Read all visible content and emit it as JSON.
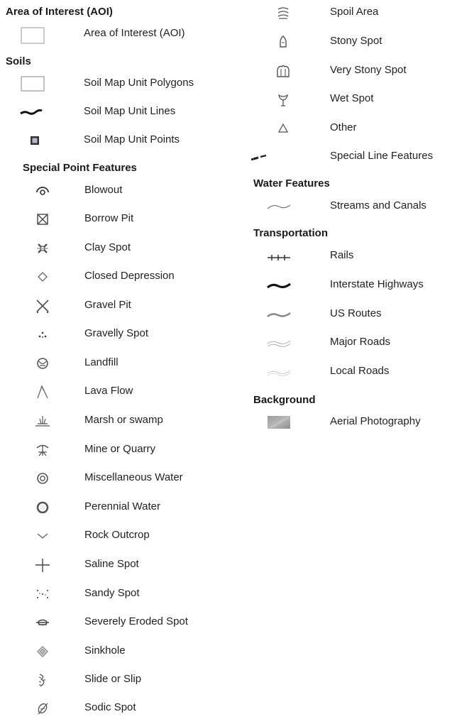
{
  "left_column": {
    "sections": [
      {
        "heading": "Area of Interest (AOI)",
        "items": [
          {
            "icon": "aoi-box-icon",
            "label": "Area of Interest (AOI)"
          }
        ]
      },
      {
        "heading": "Soils",
        "items": [
          {
            "icon": "soil-polygon-box-icon",
            "label": "Soil Map Unit Polygons"
          },
          {
            "icon": "soil-line-icon",
            "label": "Soil Map Unit Lines"
          },
          {
            "icon": "soil-point-square-icon",
            "label": "Soil Map Unit Points"
          }
        ]
      },
      {
        "heading": "Special Point Features",
        "items": [
          {
            "icon": "blowout-icon",
            "label": "Blowout"
          },
          {
            "icon": "borrow-pit-icon",
            "label": "Borrow Pit"
          },
          {
            "icon": "clay-spot-icon",
            "label": "Clay Spot"
          },
          {
            "icon": "closed-depression-icon",
            "label": "Closed Depression"
          },
          {
            "icon": "gravel-pit-icon",
            "label": "Gravel Pit"
          },
          {
            "icon": "gravelly-spot-icon",
            "label": "Gravelly Spot"
          },
          {
            "icon": "landfill-icon",
            "label": "Landfill"
          },
          {
            "icon": "lava-flow-icon",
            "label": "Lava Flow"
          },
          {
            "icon": "marsh-icon",
            "label": "Marsh or swamp"
          },
          {
            "icon": "mine-quarry-icon",
            "label": "Mine or Quarry"
          },
          {
            "icon": "misc-water-icon",
            "label": "Miscellaneous Water"
          },
          {
            "icon": "perennial-water-icon",
            "label": "Perennial Water"
          },
          {
            "icon": "rock-outcrop-icon",
            "label": "Rock Outcrop"
          },
          {
            "icon": "saline-spot-icon",
            "label": "Saline Spot"
          },
          {
            "icon": "sandy-spot-icon",
            "label": "Sandy Spot"
          },
          {
            "icon": "eroded-spot-icon",
            "label": "Severely Eroded Spot"
          },
          {
            "icon": "sinkhole-icon",
            "label": "Sinkhole"
          },
          {
            "icon": "slide-slip-icon",
            "label": "Slide or Slip"
          },
          {
            "icon": "sodic-spot-icon",
            "label": "Sodic Spot"
          }
        ]
      }
    ]
  },
  "right_column": {
    "sections": [
      {
        "heading": "",
        "items": [
          {
            "icon": "spoil-area-icon",
            "label": "Spoil Area"
          },
          {
            "icon": "stony-spot-icon",
            "label": "Stony Spot"
          },
          {
            "icon": "very-stony-spot-icon",
            "label": "Very Stony Spot"
          },
          {
            "icon": "wet-spot-icon",
            "label": "Wet Spot"
          },
          {
            "icon": "other-triangle-icon",
            "label": "Other"
          },
          {
            "icon": "special-line-icon",
            "label": "Special Line Features"
          }
        ]
      },
      {
        "heading": "Water Features",
        "items": [
          {
            "icon": "stream-line-icon",
            "label": "Streams and Canals"
          }
        ]
      },
      {
        "heading": "Transportation",
        "items": [
          {
            "icon": "rails-icon",
            "label": "Rails"
          },
          {
            "icon": "interstate-line-icon",
            "label": "Interstate Highways"
          },
          {
            "icon": "us-route-line-icon",
            "label": "US Routes"
          },
          {
            "icon": "major-road-line-icon",
            "label": "Major Roads"
          },
          {
            "icon": "local-road-line-icon",
            "label": "Local Roads"
          }
        ]
      },
      {
        "heading": "Background",
        "items": [
          {
            "icon": "aerial-photo-swatch-icon",
            "label": "Aerial Photography"
          }
        ]
      }
    ]
  }
}
